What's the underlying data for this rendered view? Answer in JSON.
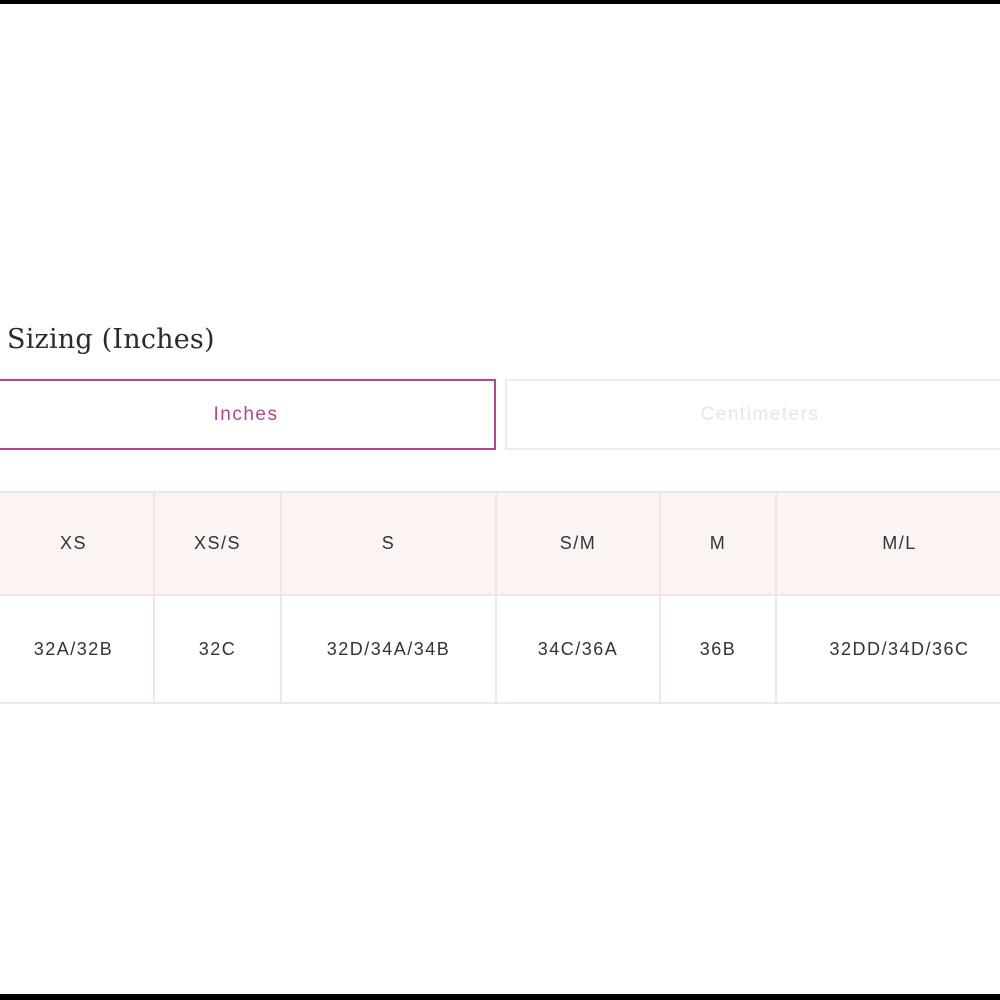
{
  "title": "Sizing (Inches)",
  "tabs": [
    {
      "label": "Inches",
      "active": true
    },
    {
      "label": "Centimeters",
      "active": false
    }
  ],
  "table": {
    "headers": [
      "XS",
      "XS/S",
      "S",
      "S/M",
      "M",
      "M/L"
    ],
    "rows": [
      [
        "32A/32B",
        "32C",
        "32D/34A/34B",
        "34C/36A",
        "36B",
        "32DD/34D/36C"
      ]
    ]
  },
  "colors": {
    "accent": "#b5468c",
    "header_bg": "#fcf4f3",
    "border": "#ebe6e8",
    "inactive_text": "#e6e6e6"
  }
}
